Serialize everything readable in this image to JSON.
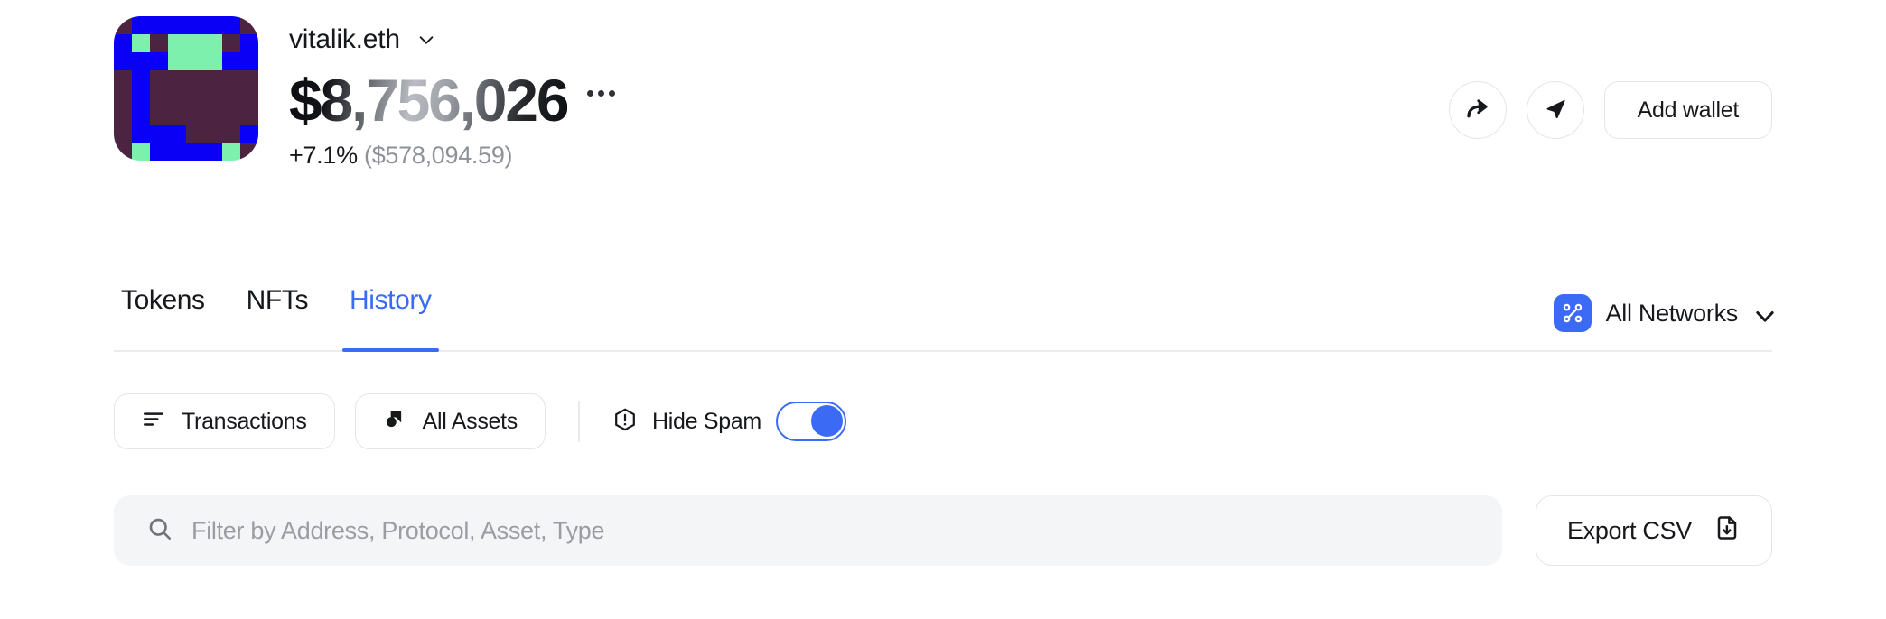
{
  "header": {
    "wallet_name": "vitalik.eth",
    "balance": "$8,756,026",
    "change_percent": "+7.1%",
    "change_amount": "($578,094.59)",
    "add_wallet_label": "Add wallet",
    "avatar": {
      "colors": {
        "background": "#4c2340",
        "primary": "#0a00f5",
        "accent": "#7df0ad"
      },
      "grid": [
        [
          "bg",
          "pr",
          "pr",
          "pr",
          "pr",
          "pr",
          "pr",
          "bg"
        ],
        [
          "pr",
          "ac",
          "bg",
          "ac",
          "ac",
          "ac",
          "bg",
          "pr"
        ],
        [
          "pr",
          "pr",
          "pr",
          "ac",
          "ac",
          "ac",
          "pr",
          "pr"
        ],
        [
          "bg",
          "pr",
          "bg",
          "bg",
          "bg",
          "bg",
          "bg",
          "bg"
        ],
        [
          "bg",
          "pr",
          "bg",
          "bg",
          "bg",
          "bg",
          "bg",
          "bg"
        ],
        [
          "bg",
          "pr",
          "bg",
          "bg",
          "bg",
          "bg",
          "bg",
          "bg"
        ],
        [
          "bg",
          "pr",
          "pr",
          "pr",
          "bg",
          "bg",
          "bg",
          "pr"
        ],
        [
          "bg",
          "ac",
          "pr",
          "pr",
          "pr",
          "pr",
          "ac",
          "bg"
        ]
      ]
    }
  },
  "tabs": {
    "items": [
      {
        "label": "Tokens",
        "active": false
      },
      {
        "label": "NFTs",
        "active": false
      },
      {
        "label": "History",
        "active": true
      }
    ],
    "networks_label": "All Networks"
  },
  "filters": {
    "transactions_label": "Transactions",
    "all_assets_label": "All Assets",
    "hide_spam_label": "Hide Spam",
    "hide_spam_on": true
  },
  "search": {
    "placeholder": "Filter by Address, Protocol, Asset, Type",
    "value": "",
    "export_label": "Export CSV"
  },
  "colors": {
    "accent": "#3b6af5",
    "text": "#16181c",
    "muted": "#8e9298",
    "border": "#e3e5e8",
    "field_bg": "#f4f5f6"
  }
}
